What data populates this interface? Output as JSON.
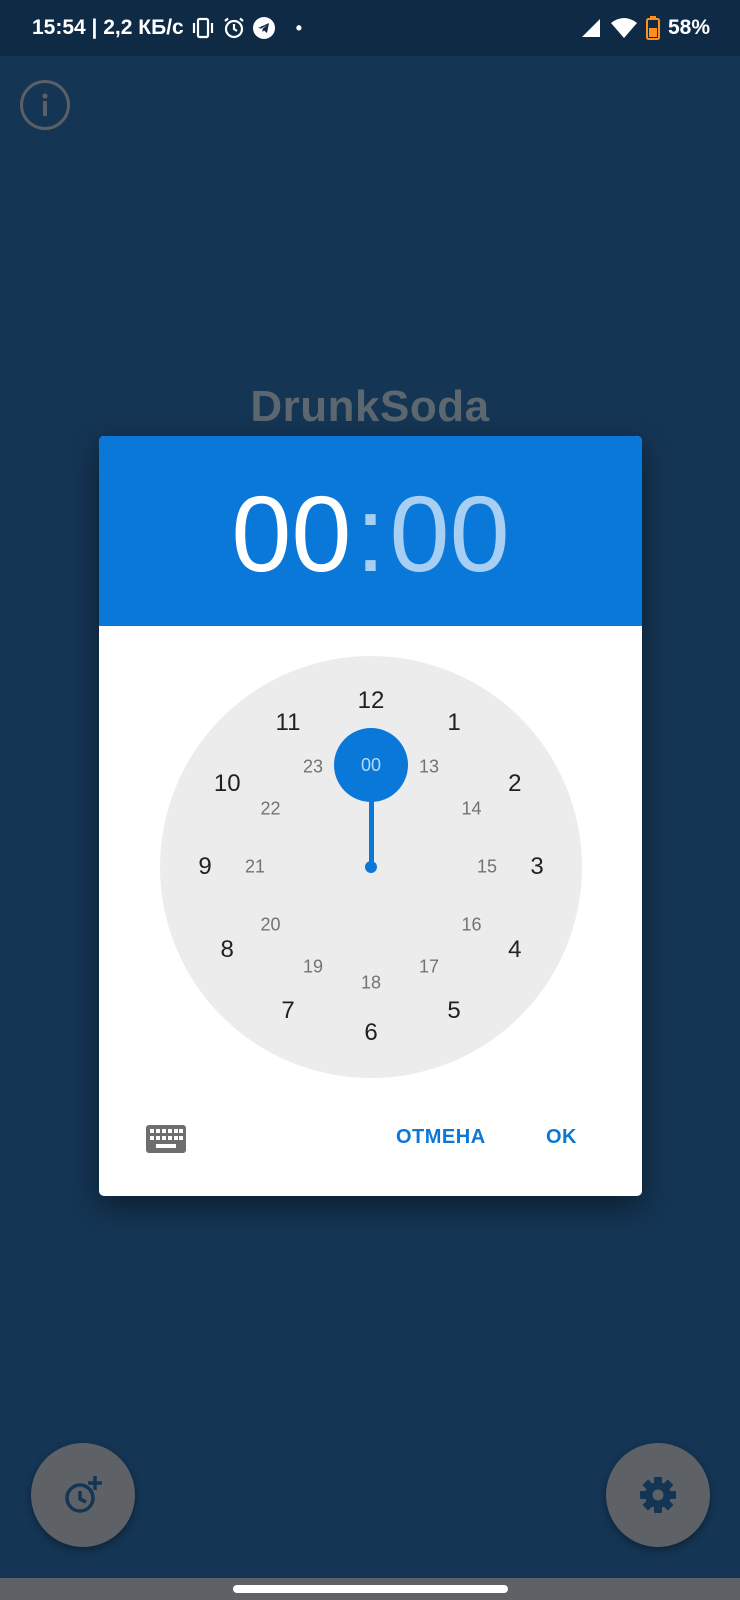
{
  "status_bar": {
    "time_speed": "15:54 | 2,2 КБ/с",
    "battery": "58%",
    "icons": [
      "vibrate-icon",
      "alarm-icon",
      "telegram-icon",
      "signal-icon",
      "wifi-icon",
      "battery-icon"
    ]
  },
  "app": {
    "title": "DrunkSoda",
    "info_icon": "info-icon",
    "fab_left_icon": "add-alarm-icon",
    "fab_right_icon": "settings-icon"
  },
  "dialog": {
    "hours": "00",
    "separator": ":",
    "minutes": "00",
    "selected_value": "00",
    "outer_numbers": [
      "12",
      "1",
      "2",
      "3",
      "4",
      "5",
      "6",
      "7",
      "8",
      "9",
      "10",
      "11"
    ],
    "inner_numbers": [
      "00",
      "13",
      "14",
      "15",
      "16",
      "17",
      "18",
      "19",
      "20",
      "21",
      "22",
      "23"
    ],
    "cancel_label": "ОТМЕНА",
    "ok_label": "OK",
    "keyboard_icon": "keyboard-icon"
  },
  "colors": {
    "accent": "#0a78d8",
    "background": "#143554",
    "status_bar": "#0f2a45",
    "clock_face": "#ececec",
    "fab": "#5e6166"
  }
}
